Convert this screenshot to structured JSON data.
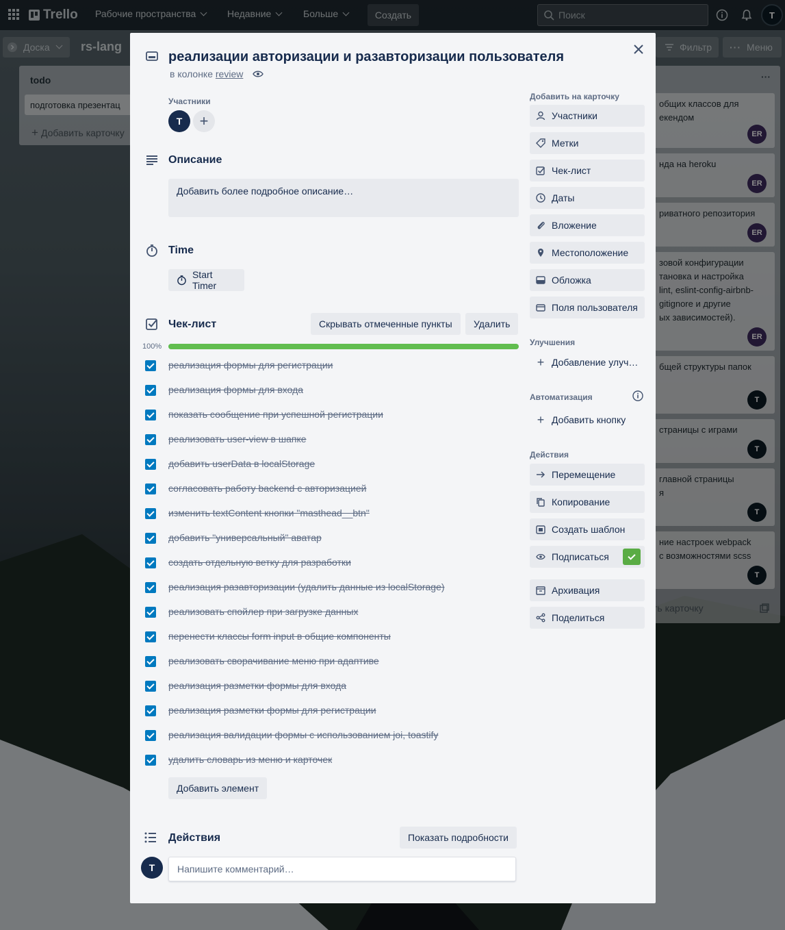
{
  "topbar": {
    "logo": "Trello",
    "menu": [
      "Рабочие пространства",
      "Недавние",
      "Больше"
    ],
    "create_label": "Создать",
    "search_placeholder": "Поиск",
    "avatar_initial": "T"
  },
  "board": {
    "view_label": "Доска",
    "title": "rs-lang",
    "filter_label": "Фильтр",
    "menu_label": "Меню"
  },
  "left_list": {
    "title": "todo",
    "card": "подготовка презентац",
    "add_card": "Добавить карточку"
  },
  "right_list": {
    "more": "···",
    "cards": [
      {
        "text": "общих классов для\nекендом",
        "avatar": "ER"
      },
      {
        "text": "нда на heroku",
        "avatar": "ER"
      },
      {
        "text": "риватного репозитория",
        "avatar": "ER"
      },
      {
        "text": "зовой конфигурации\nтановка и настройка\nlint, eslint-config-airbnb-\ngitignore и другие\nых зависимостей).",
        "avatar": "ER"
      },
      {
        "text": "бщей структуры папок",
        "avatar": "T"
      },
      {
        "text": "страницы с играми",
        "avatar": "T"
      },
      {
        "text": "главной страницы\nя",
        "avatar": "T"
      },
      {
        "text": "ние настроек webpack\nс возможностями scss",
        "avatar": "T"
      }
    ],
    "add_card": "ть карточку"
  },
  "card": {
    "title": "реализации авторизации и разавторизации пользователя",
    "in_column_prefix": "в колонке",
    "column": "review",
    "members_label": "Участники",
    "member_initial": "T",
    "description_title": "Описание",
    "description_placeholder": "Добавить более подробное описание…",
    "time_title": "Time",
    "start_timer": "Start Timer",
    "checklist_title": "Чек-лист",
    "hide_checked": "Скрывать отмеченные пункты",
    "delete": "Удалить",
    "progress_label": "100%",
    "progress": 1.0,
    "checklist_items": [
      "реализация формы для регистрации",
      "реализация формы для входа",
      "показать сообщение при успешной регистрации",
      "реализовать user-view в шапке",
      "добавить userData в localStorage",
      "согласовать работу backend с авторизацией",
      "изменить textContent кнопки \"masthead__btn\"",
      "добавить \"универсальный\" аватар",
      "создать отдельную ветку для разработки",
      "реализация разавторизации (удалить данные из localStorage)",
      "реализовать спойлер при загрузке данных",
      "перенести классы form input в общие компоненты",
      "реализовать сворачивание меню при адаптиве",
      "реализация разметки формы для входа",
      "реализация разметки формы для регистрации",
      "реализация валидации формы с использованием joi, toastify",
      "удалить словарь из меню и карточек"
    ],
    "add_item": "Добавить элемент",
    "activity_title": "Действия",
    "show_details": "Показать подробности",
    "comment_placeholder": "Напишите комментарий…"
  },
  "sidebar": {
    "add_to_card_label": "Добавить на карточку",
    "add_buttons": [
      "Участники",
      "Метки",
      "Чек-лист",
      "Даты",
      "Вложение",
      "Местоположение",
      "Обложка",
      "Поля пользователя"
    ],
    "improvements_label": "Улучшения",
    "add_improvement": "Добавление улуч…",
    "automation_label": "Автоматизация",
    "add_button": "Добавить кнопку",
    "actions_label": "Действия",
    "actions": [
      "Перемещение",
      "Копирование",
      "Создать шаблон",
      "Подписаться"
    ],
    "actions2": [
      "Архивация",
      "Поделиться"
    ]
  },
  "colors": {
    "accent_blue": "#0079bf",
    "progress_green": "#61bd4f",
    "subscribe_green": "#5aac44",
    "avatar_dark": "#172b4d",
    "avatar_purple": "#3d2b5e"
  }
}
